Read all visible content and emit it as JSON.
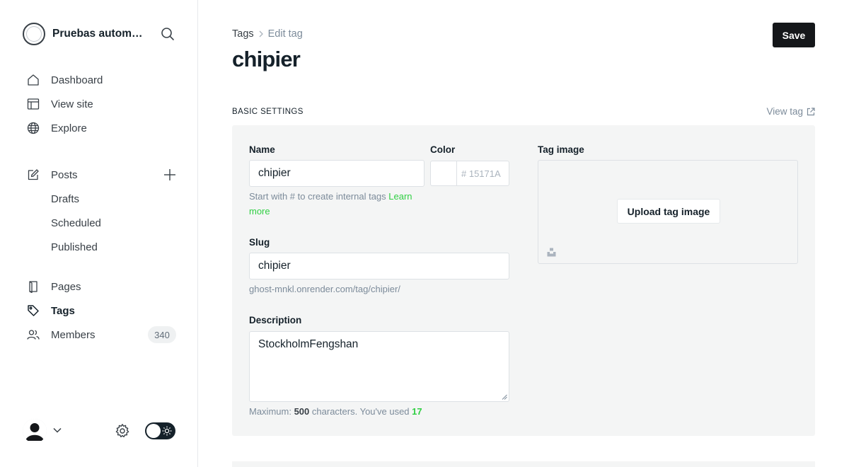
{
  "sidebar": {
    "site_title": "Pruebas automa…",
    "nav": {
      "dashboard": "Dashboard",
      "view_site": "View site",
      "explore": "Explore",
      "posts": "Posts",
      "drafts": "Drafts",
      "scheduled": "Scheduled",
      "published": "Published",
      "pages": "Pages",
      "tags": "Tags",
      "members": "Members",
      "members_count": "340"
    },
    "active_item": "Tags"
  },
  "header": {
    "breadcrumb_parent": "Tags",
    "breadcrumb_separator": ">",
    "breadcrumb_current": "Edit tag",
    "title": "chipier",
    "save_label": "Save"
  },
  "section": {
    "label": "BASIC SETTINGS",
    "view_tag": "View tag"
  },
  "form": {
    "name_label": "Name",
    "name_value": "chipier",
    "name_hint": "Start with # to create internal tags",
    "name_hint_link": "Learn more",
    "color_label": "Color",
    "color_placeholder": "# 15171A",
    "slug_label": "Slug",
    "slug_value": "chipier",
    "slug_url": "ghost-mnkl.onrender.com/tag/chipier/",
    "description_label": "Description",
    "description_value": "StockholmFengshan",
    "description_hint_prefix": "Maximum:",
    "description_max": "500",
    "description_hint_mid": "characters. You've used",
    "description_used": "17",
    "image_label": "Tag image",
    "upload_label": "Upload tag image"
  },
  "colors": {
    "accent_green": "#30cf43",
    "primary_dark": "#15171a",
    "panel_bg": "#f4f5f5"
  },
  "icons": [
    "search-icon",
    "home-icon",
    "view-site-icon",
    "globe-icon",
    "edit-icon",
    "plus-icon",
    "page-icon",
    "tag-icon",
    "members-icon",
    "avatar-icon",
    "chevron-down-icon",
    "gear-icon",
    "sun-icon",
    "external-link-icon",
    "unsplash-icon"
  ]
}
